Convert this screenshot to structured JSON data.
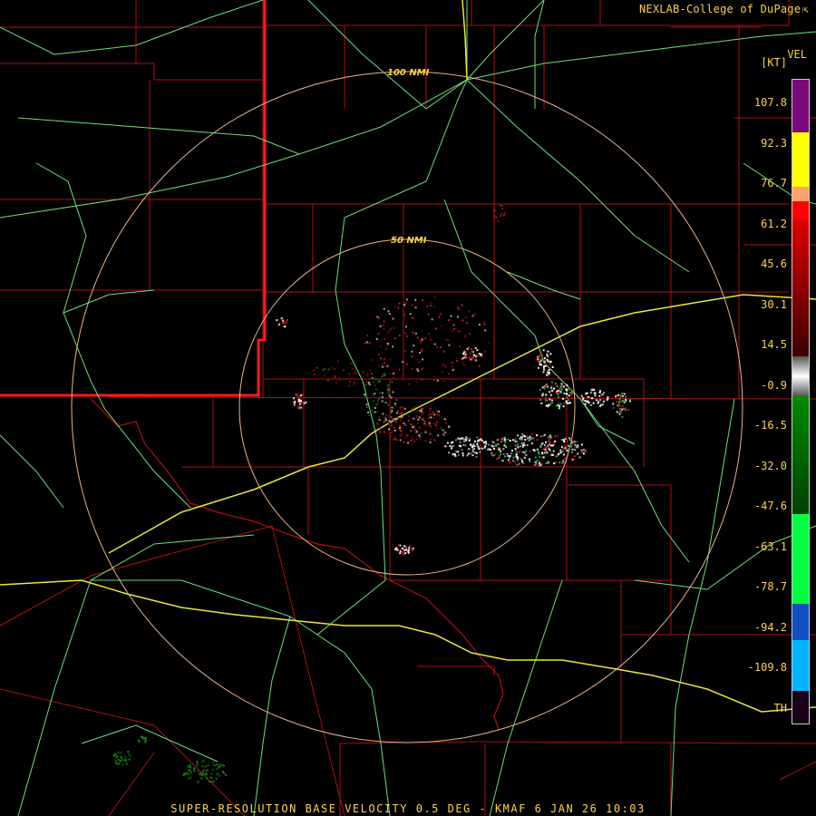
{
  "credit": {
    "text": "NEXLAB-College of DuPage",
    "icon": "external-link-icon"
  },
  "legend": {
    "title": "VEL",
    "unit": "[KT]",
    "labels": [
      "107.8",
      "92.3",
      "76.7",
      "61.2",
      "45.6",
      "30.1",
      "14.5",
      "-0.9",
      "-16.5",
      "-32.0",
      "-47.6",
      "-63.1",
      "-78.7",
      "-94.2",
      "-109.8",
      "TH"
    ],
    "colors": {
      "purple": "#7a0a7a",
      "yellow": "#ffff00",
      "orange": "#ffa070",
      "red": "#ff0000",
      "dark_red": "#3a0000",
      "gray": "#d8d8d8",
      "dark_green": "#004000",
      "green": "#00ff40",
      "blue": "#1050c0",
      "cyan": "#00b4ff",
      "dark_purple": "#1a001a"
    }
  },
  "range_rings": [
    {
      "label": "100 NMI",
      "radius_nmi": 100
    },
    {
      "label": "50 NMI",
      "radius_nmi": 50
    }
  ],
  "caption": "SUPER-RESOLUTION BASE VELOCITY 0.5 DEG - KMAF 6 JAN 26 10:03",
  "map_colors": {
    "county_lines": "#b01010",
    "state_line": "#ff1a1a",
    "highways": "#6ee07a",
    "interstates": "#e8e83a",
    "rings": "#e8b48a"
  }
}
